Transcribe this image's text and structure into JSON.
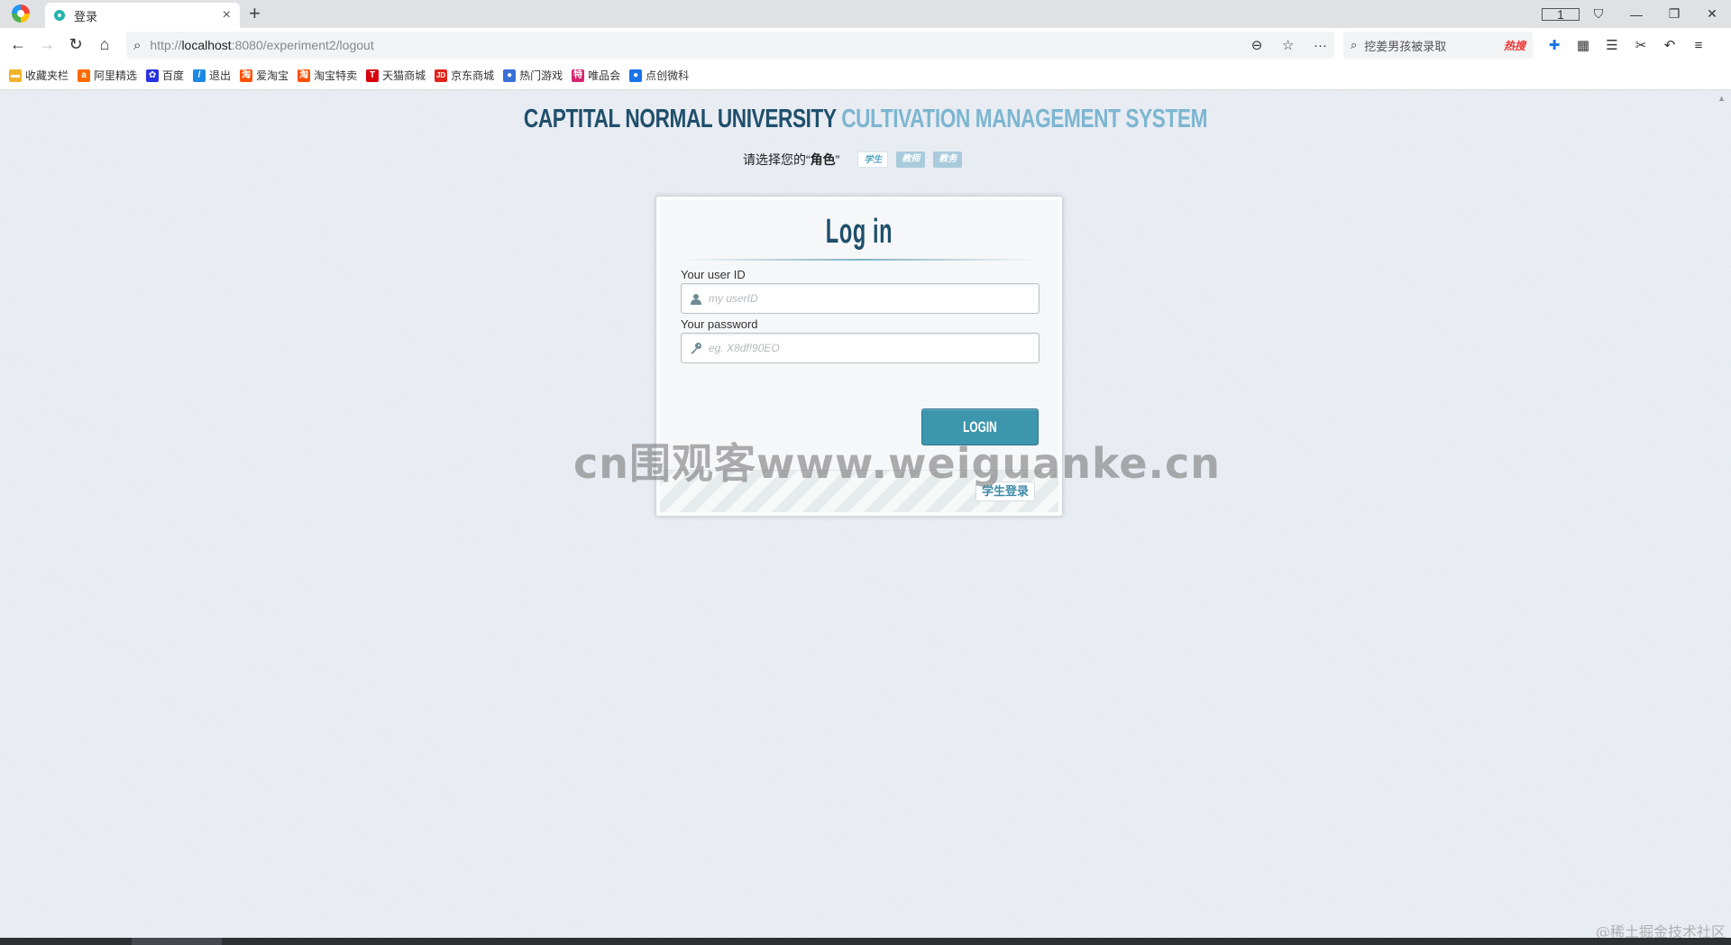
{
  "browser": {
    "tab_title": "登录",
    "tab_close": "×",
    "new_tab": "+",
    "url_host": "localhost",
    "url_prefix": "http://",
    "url_rest": ":8080/experiment2/logout",
    "search_text": "挖姜男孩被录取",
    "hot_label": "热搜",
    "tab_count": "1"
  },
  "bookmarks": [
    {
      "label": "收藏夹栏",
      "icon": "folder-icon",
      "color": "#f0b429"
    },
    {
      "label": "阿里精选",
      "icon": "ali-icon",
      "color": "#ff6a00"
    },
    {
      "label": "百度",
      "icon": "baidu-icon",
      "color": "#2932e1"
    },
    {
      "label": "退出",
      "icon": "feather-icon",
      "color": "#1e88e5"
    },
    {
      "label": "爱淘宝",
      "icon": "taobao-icon",
      "color": "#ff5000"
    },
    {
      "label": "淘宝特卖",
      "icon": "taobao-sale-icon",
      "color": "#ff5000"
    },
    {
      "label": "天猫商城",
      "icon": "tmall-icon",
      "color": "#d8000f"
    },
    {
      "label": "京东商城",
      "icon": "jd-icon",
      "color": "#e1251b"
    },
    {
      "label": "热门游戏",
      "icon": "game-icon",
      "color": "#3a6fd8"
    },
    {
      "label": "唯品会",
      "icon": "vip-icon",
      "color": "#d6246e"
    },
    {
      "label": "点创微科",
      "icon": "dianchuang-icon",
      "color": "#1a73e8"
    }
  ],
  "page": {
    "title_part1": "CAPTITAL NORMAL UNIVERSITY",
    "title_part2": "CULTIVATION MANAGEMENT SYSTEM",
    "role_prompt": "请选择您的“",
    "role_prompt_bold": "角色",
    "role_prompt_end": "”",
    "roles": [
      "学生",
      "教师",
      "教务"
    ]
  },
  "login": {
    "heading": "Log in",
    "userid_label": "Your user ID",
    "userid_placeholder": "my userID",
    "password_label": "Your password",
    "password_placeholder": "eg. X8df!90EO",
    "submit_label": "LOGIN",
    "switch_label": "学生登录"
  },
  "overlay": {
    "watermark": "cn围观客www.weiguanke.cn",
    "corner": "@稀土掘金技术社区"
  },
  "colors": {
    "title_dark": "#1f4f6b",
    "title_light": "#7cb6d0",
    "login_button": "#3d96ae"
  }
}
